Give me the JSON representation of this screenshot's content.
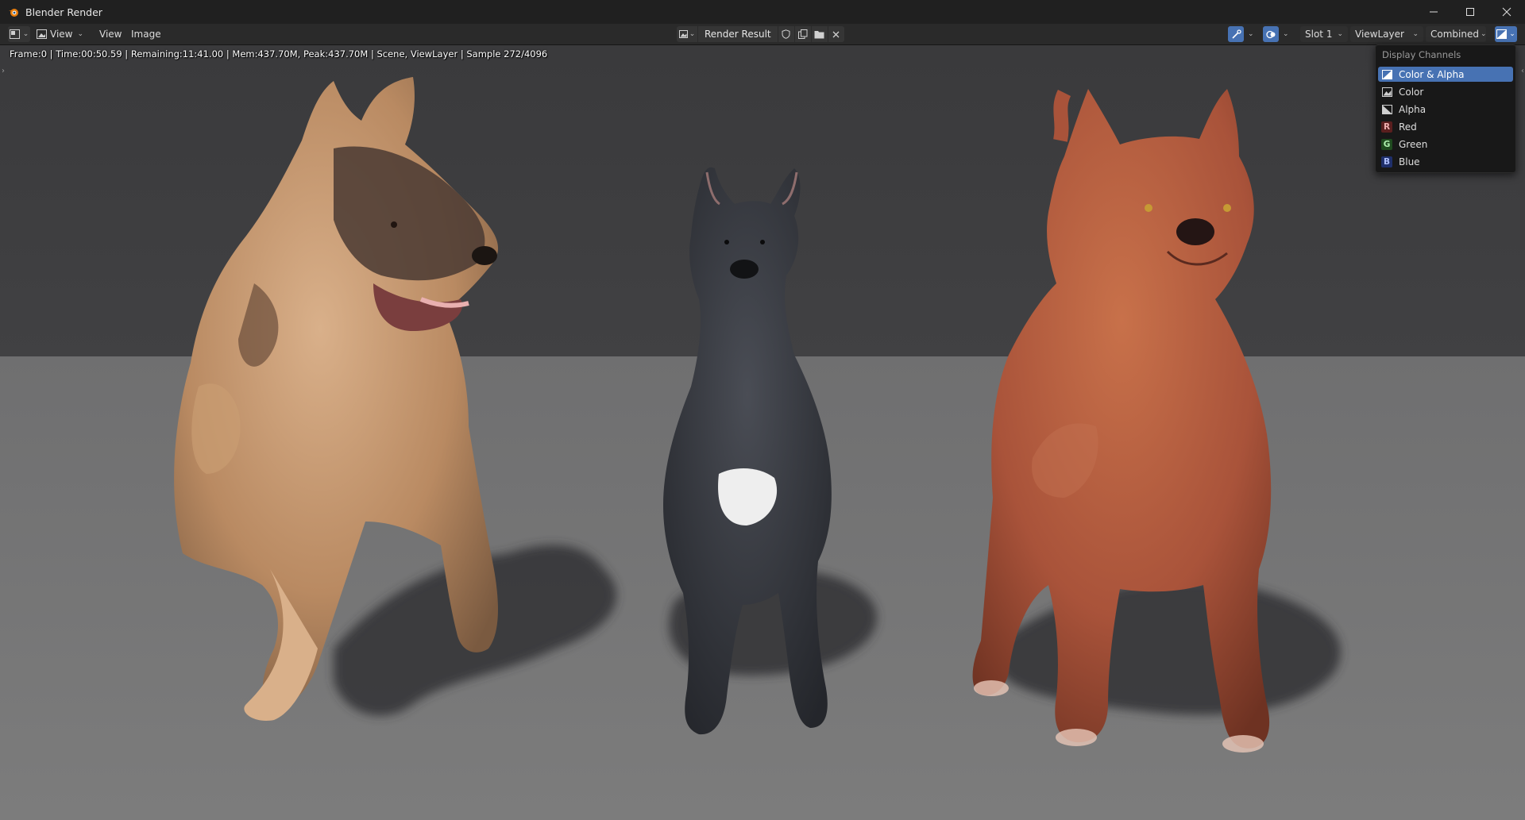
{
  "window": {
    "title": "Blender Render",
    "controls": {
      "minimize": "—",
      "maximize": "☐",
      "close": "✕"
    }
  },
  "header": {
    "view_mode_label": "View",
    "menus": {
      "view": "View",
      "image": "Image"
    },
    "image_name": "Render Result",
    "slot": "Slot 1",
    "view_layer": "ViewLayer",
    "pass": "Combined"
  },
  "stats": {
    "text": "Frame:0 | Time:00:50.59 | Remaining:11:41.00 | Mem:437.70M, Peak:437.70M | Scene, ViewLayer | Sample 272/4096"
  },
  "display_channels": {
    "title": "Display Channels",
    "items": [
      {
        "label": "Color & Alpha",
        "selected": true,
        "icon": "color-alpha-icon"
      },
      {
        "label": "Color",
        "selected": false,
        "icon": "color-icon"
      },
      {
        "label": "Alpha",
        "selected": false,
        "icon": "alpha-icon"
      },
      {
        "label": "Red",
        "letter": "R",
        "selected": false,
        "icon": "red-channel-icon",
        "color": "#c23b3b"
      },
      {
        "label": "Green",
        "letter": "G",
        "selected": false,
        "icon": "green-channel-icon",
        "color": "#3b9b3b"
      },
      {
        "label": "Blue",
        "letter": "B",
        "selected": false,
        "icon": "blue-channel-icon",
        "color": "#3b5fc2"
      }
    ]
  },
  "colors": {
    "accent": "#4772b3",
    "header_bg": "#2a2a2a",
    "backdrop": "#3d3d3f",
    "floor": "#737373"
  }
}
